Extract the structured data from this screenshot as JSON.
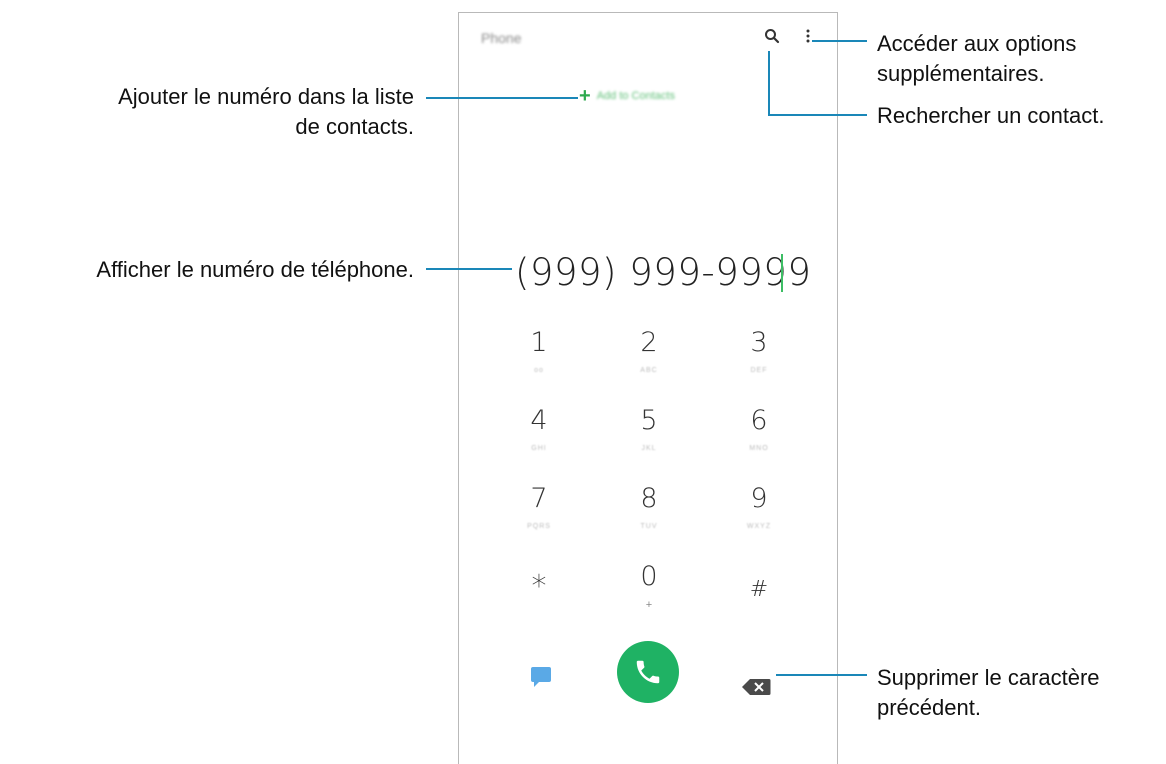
{
  "phone": {
    "title": "Phone",
    "add_to_contacts": "Add to Contacts",
    "number": "(999) 999-9999",
    "keys": [
      {
        "digit": "1",
        "letters": "oo"
      },
      {
        "digit": "2",
        "letters": "ABC"
      },
      {
        "digit": "3",
        "letters": "DEF"
      },
      {
        "digit": "4",
        "letters": "GHI"
      },
      {
        "digit": "5",
        "letters": "JKL"
      },
      {
        "digit": "6",
        "letters": "MNO"
      },
      {
        "digit": "7",
        "letters": "PQRS"
      },
      {
        "digit": "8",
        "letters": "TUV"
      },
      {
        "digit": "9",
        "letters": "WXYZ"
      },
      {
        "digit": "*",
        "letters": ""
      },
      {
        "digit": "0",
        "letters": "+"
      },
      {
        "digit": "#",
        "letters": ""
      }
    ],
    "colors": {
      "call": "#1fb264",
      "accent": "#2eaa4f",
      "message": "#5aa9e6",
      "leader": "#1a87b8"
    }
  },
  "annotations": {
    "add_contact": [
      "Ajouter le numéro dans la liste",
      "de contacts."
    ],
    "show_number": "Afficher le numéro de téléphone.",
    "more_options": [
      "Accéder aux options",
      "supplémentaires."
    ],
    "search_contact": "Rechercher un contact.",
    "delete_char": [
      "Supprimer le caractère",
      "précédent."
    ]
  }
}
